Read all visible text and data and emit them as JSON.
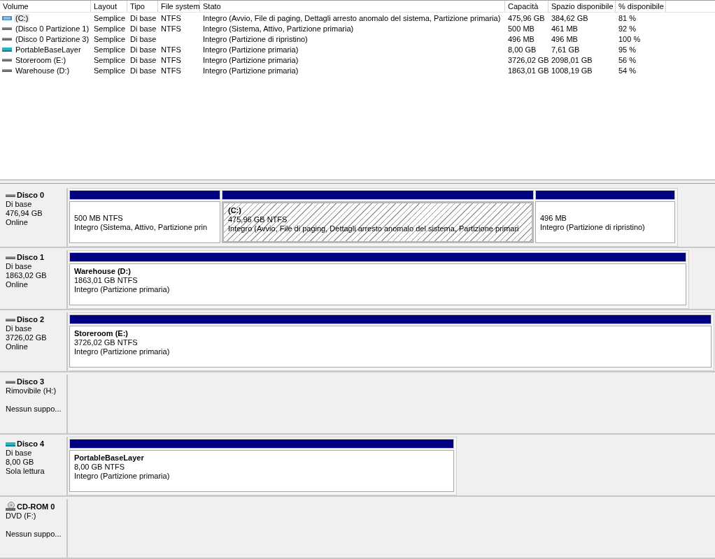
{
  "volume_table": {
    "columns": [
      "Volume",
      "Layout",
      "Tipo",
      "File system",
      "Stato",
      "Capacità",
      "Spazio disponibile",
      "% disponibile"
    ],
    "rows": [
      {
        "kind": "system",
        "selected": true,
        "cells": [
          "(C:)",
          "Semplice",
          "Di base",
          "NTFS",
          "Integro (Avvio, File di paging, Dettagli arresto anomalo del sistema, Partizione primaria)",
          "475,96 GB",
          "384,62 GB",
          "81 %"
        ]
      },
      {
        "kind": "hdd",
        "selected": false,
        "cells": [
          "(Disco 0 Partizione 1)",
          "Semplice",
          "Di base",
          "NTFS",
          "Integro (Sistema, Attivo, Partizione primaria)",
          "500 MB",
          "461 MB",
          "92 %"
        ]
      },
      {
        "kind": "hdd",
        "selected": false,
        "cells": [
          "(Disco 0 Partizione 3)",
          "Semplice",
          "Di base",
          null,
          "Integro (Partizione di ripristino)",
          "496 MB",
          "496 MB",
          "100 %"
        ]
      },
      {
        "kind": "vhd",
        "selected": false,
        "cells": [
          "PortableBaseLayer",
          "Semplice",
          "Di base",
          "NTFS",
          "Integro (Partizione primaria)",
          "8,00 GB",
          "7,61 GB",
          "95 %"
        ]
      },
      {
        "kind": "hdd",
        "selected": false,
        "cells": [
          "Storeroom (E:)",
          "Semplice",
          "Di base",
          "NTFS",
          "Integro (Partizione primaria)",
          "3726,02 GB",
          "2098,01 GB",
          "56 %"
        ]
      },
      {
        "kind": "hdd",
        "selected": false,
        "cells": [
          "Warehouse (D:)",
          "Semplice",
          "Di base",
          "NTFS",
          "Integro (Partizione primaria)",
          "1863,01 GB",
          "1008,19 GB",
          "54 %"
        ]
      }
    ]
  },
  "disks": [
    {
      "kind": "hdd",
      "name": "Disco 0",
      "type": "Di base",
      "size": "476,94 GB",
      "status": "Online",
      "partitions": [
        {
          "selected": false,
          "size_fs": "500 MB NTFS",
          "status": "Integro (Sistema, Attivo, Partizione prin"
        },
        {
          "selected": true,
          "title": "(C:)",
          "size_fs": "475,96 GB NTFS",
          "status": "Integro (Avvio, File di paging, Dettagli arresto anomalo del sistema, Partizione primari"
        },
        {
          "selected": false,
          "size_fs": "496 MB",
          "status": "Integro (Partizione di ripristino)"
        }
      ]
    },
    {
      "kind": "hdd",
      "name": "Disco 1",
      "type": "Di base",
      "size": "1863,02 GB",
      "status": "Online",
      "partitions": [
        {
          "selected": false,
          "title": "Warehouse  (D:)",
          "size_fs": "1863,01 GB NTFS",
          "status": "Integro (Partizione primaria)"
        }
      ]
    },
    {
      "kind": "hdd",
      "name": "Disco 2",
      "type": "Di base",
      "size": "3726,02 GB",
      "status": "Online",
      "partitions": [
        {
          "selected": false,
          "title": "Storeroom  (E:)",
          "size_fs": "3726,02 GB NTFS",
          "status": "Integro (Partizione primaria)"
        }
      ]
    },
    {
      "kind": "hdd",
      "name": "Disco 3",
      "type": "Rimovibile (H:)",
      "status": "Nessun suppo..."
    },
    {
      "kind": "vhd",
      "name": "Disco 4",
      "type": "Di base",
      "size": "8,00 GB",
      "status": "Sola lettura",
      "partitions": [
        {
          "selected": false,
          "title": "PortableBaseLayer",
          "size_fs": "8,00 GB NTFS",
          "status": "Integro (Partizione primaria)"
        }
      ]
    },
    {
      "kind": "cdrom",
      "name": "CD-ROM 0",
      "type": "DVD (F:)",
      "status": "Nessun suppo..."
    }
  ]
}
